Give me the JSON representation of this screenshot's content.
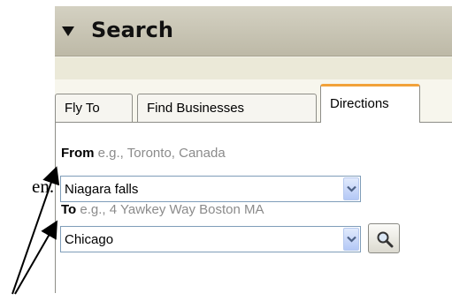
{
  "document": {
    "fragment_text": "en."
  },
  "panel": {
    "header": {
      "title": "Search",
      "collapse_icon": "triangle-down-icon"
    },
    "tabs": [
      {
        "label": "Fly To",
        "active": false
      },
      {
        "label": "Find Businesses",
        "active": false
      },
      {
        "label": "Directions",
        "active": true
      }
    ],
    "from": {
      "label": "From",
      "hint": " e.g., Toronto, Canada",
      "value": "Niagara falls"
    },
    "to": {
      "label": "To",
      "hint": " e.g., 4 Yawkey Way Boston MA",
      "value": "Chicago"
    },
    "search_button_icon": "magnifier-icon"
  },
  "colors": {
    "active_tab_accent": "#f2a23a",
    "header_bg": "#c9c6b5",
    "combo_border": "#7f9db9"
  }
}
